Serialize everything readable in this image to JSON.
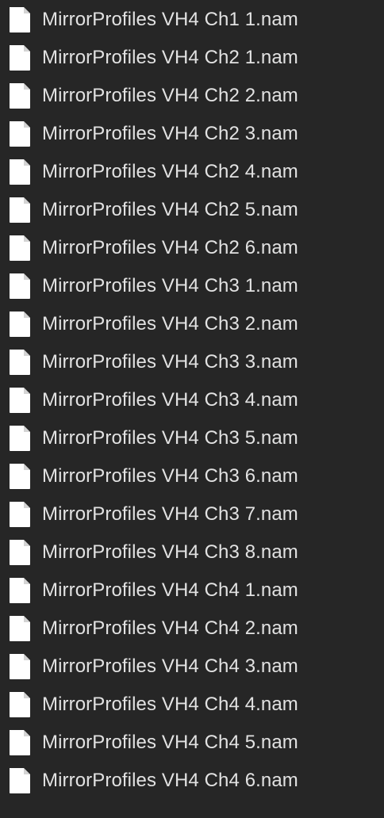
{
  "file_list": {
    "items": [
      {
        "name": "MirrorProfiles VH4 Ch1 1.nam",
        "icon": "document-icon"
      },
      {
        "name": "MirrorProfiles VH4 Ch2 1.nam",
        "icon": "document-icon"
      },
      {
        "name": "MirrorProfiles VH4 Ch2 2.nam",
        "icon": "document-icon"
      },
      {
        "name": "MirrorProfiles VH4 Ch2 3.nam",
        "icon": "document-icon"
      },
      {
        "name": "MirrorProfiles VH4 Ch2 4.nam",
        "icon": "document-icon"
      },
      {
        "name": "MirrorProfiles VH4 Ch2 5.nam",
        "icon": "document-icon"
      },
      {
        "name": "MirrorProfiles VH4 Ch2 6.nam",
        "icon": "document-icon"
      },
      {
        "name": "MirrorProfiles VH4 Ch3 1.nam",
        "icon": "document-icon"
      },
      {
        "name": "MirrorProfiles VH4 Ch3 2.nam",
        "icon": "document-icon"
      },
      {
        "name": "MirrorProfiles VH4 Ch3 3.nam",
        "icon": "document-icon"
      },
      {
        "name": "MirrorProfiles VH4 Ch3 4.nam",
        "icon": "document-icon"
      },
      {
        "name": "MirrorProfiles VH4 Ch3 5.nam",
        "icon": "document-icon"
      },
      {
        "name": "MirrorProfiles VH4 Ch3 6.nam",
        "icon": "document-icon"
      },
      {
        "name": "MirrorProfiles VH4 Ch3 7.nam",
        "icon": "document-icon"
      },
      {
        "name": "MirrorProfiles VH4 Ch3 8.nam",
        "icon": "document-icon"
      },
      {
        "name": "MirrorProfiles VH4 Ch4 1.nam",
        "icon": "document-icon"
      },
      {
        "name": "MirrorProfiles VH4 Ch4 2.nam",
        "icon": "document-icon"
      },
      {
        "name": "MirrorProfiles VH4 Ch4 3.nam",
        "icon": "document-icon"
      },
      {
        "name": "MirrorProfiles VH4 Ch4 4.nam",
        "icon": "document-icon"
      },
      {
        "name": "MirrorProfiles VH4 Ch4 5.nam",
        "icon": "document-icon"
      },
      {
        "name": "MirrorProfiles VH4 Ch4 6.nam",
        "icon": "document-icon"
      }
    ]
  },
  "colors": {
    "background": "#262626",
    "text": "#e2e2e2",
    "icon_fill": "#ffffff",
    "icon_fold": "#d4d4d4"
  }
}
